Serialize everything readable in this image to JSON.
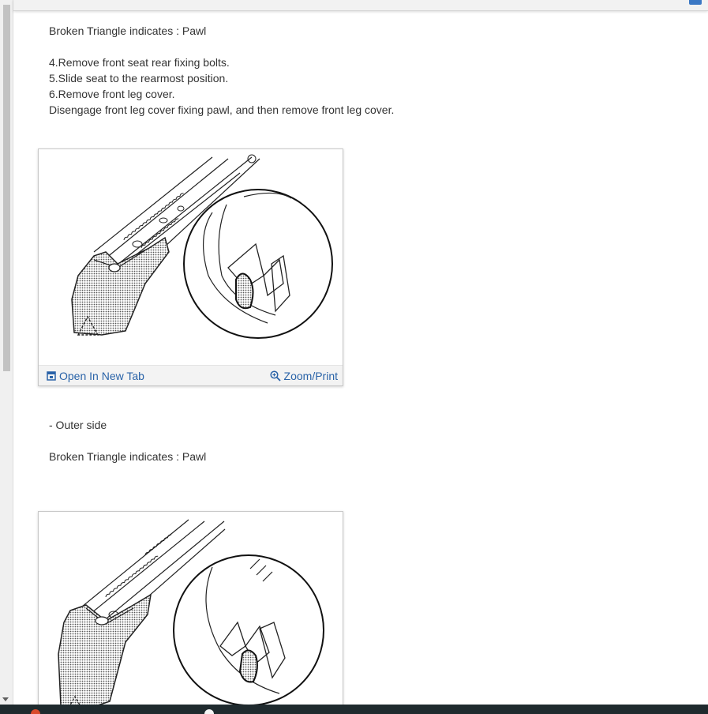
{
  "section1": {
    "line1": "Broken Triangle indicates : Pawl",
    "step4": "4.Remove front seat rear fixing bolts.",
    "step5": "5.Slide seat to the rearmost position.",
    "step6": "6.Remove front leg cover.",
    "note": "Disengage front leg cover fixing pawl, and then remove front leg cover."
  },
  "figure1": {
    "open_label": "Open In New Tab",
    "zoom_label": "Zoom/Print"
  },
  "section2": {
    "outer": "- Outer side",
    "line1": "Broken Triangle indicates : Pawl"
  },
  "colors": {
    "link": "#2a63a8",
    "text": "#333333",
    "chip": "#3b78c4"
  },
  "icons": [
    "open-new-tab-icon",
    "zoom-icon"
  ]
}
